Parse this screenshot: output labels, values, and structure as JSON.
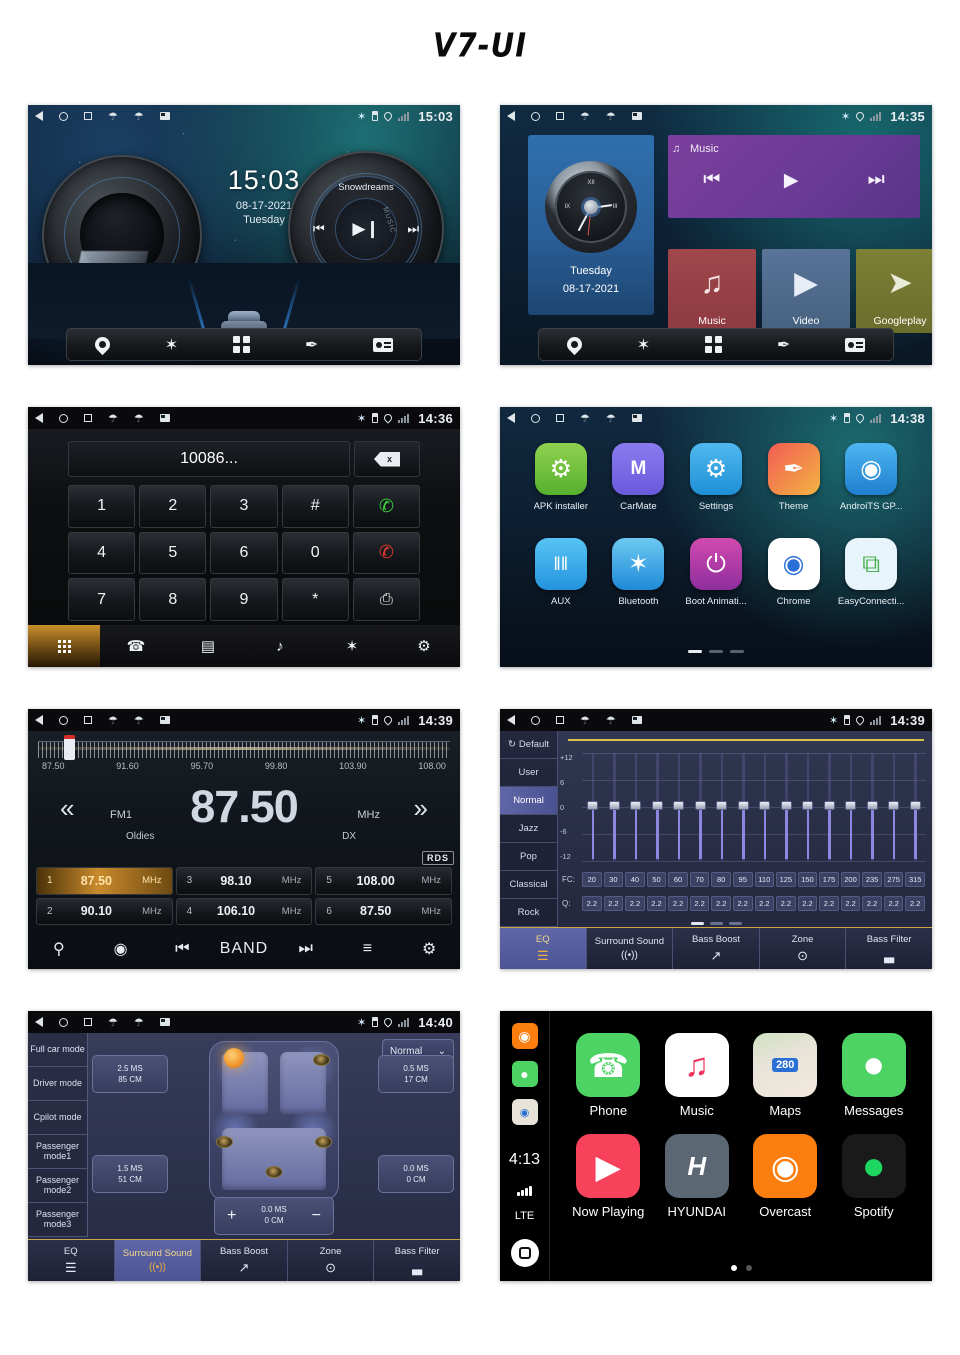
{
  "page": {
    "title": "V7-UI"
  },
  "panels": [
    {
      "id": "home-screen",
      "status": {
        "time": "15:03",
        "nav_icons": [
          "back-icon",
          "home-icon",
          "recents-icon",
          "usb-icon",
          "usb-icon",
          "sd-card-icon"
        ],
        "right_icons": [
          "bluetooth-icon",
          "battery-icon",
          "location-icon",
          "signal-icon"
        ]
      },
      "clock": {
        "time": "15:03",
        "date": "08-17-2021",
        "day": "Tuesday"
      },
      "media": {
        "track": "Snowdreams",
        "label": "MUSIC",
        "prev": "⏮",
        "play": "▶❙",
        "next": "⏭",
        "bluetooth": "✶"
      },
      "dock": [
        "navigation-icon",
        "bluetooth-icon",
        "apps-icon",
        "theme-icon",
        "radio-icon"
      ]
    },
    {
      "id": "widget-screen",
      "status": {
        "time": "14:35"
      },
      "clock_widget": {
        "day": "Tuesday",
        "date": "08-17-2021",
        "n12": "XII",
        "n3": "III",
        "n9": "IX"
      },
      "music_widget": {
        "title": "Music",
        "note": "♫",
        "prev": "⏮",
        "play": "▶",
        "next": "⏭"
      },
      "tiles": [
        {
          "label": "Music",
          "glyph": "♫"
        },
        {
          "label": "Video",
          "glyph": "▶"
        },
        {
          "label": "Googleplay",
          "glyph": "➤"
        }
      ],
      "dock": [
        "navigation-icon",
        "bluetooth-icon",
        "apps-icon",
        "theme-icon",
        "radio-icon"
      ]
    },
    {
      "id": "dialer-screen",
      "status": {
        "time": "14:36"
      },
      "input": {
        "value": "10086...",
        "delete_label": "x"
      },
      "keys": [
        "1",
        "2",
        "3",
        "#",
        "✆",
        "4",
        "5",
        "6",
        "0",
        "✆",
        "7",
        "8",
        "9",
        "*",
        "⎙"
      ],
      "bottom": [
        "keypad-icon",
        "call-log-icon",
        "contacts-icon",
        "bt-audio-icon",
        "bt-phone-icon",
        "settings-icon"
      ]
    },
    {
      "id": "app-drawer",
      "status": {
        "time": "14:38"
      },
      "apps": [
        {
          "label": "APK installer",
          "glyph": "⚙",
          "color1": "#8fd14f",
          "color2": "#57b02e"
        },
        {
          "label": "CarMate",
          "glyph": "M",
          "color1": "#8b7bf0",
          "color2": "#6a5adc"
        },
        {
          "label": "Settings",
          "glyph": "⚙",
          "color1": "#4fb9ef",
          "color2": "#1f8fd6"
        },
        {
          "label": "Theme",
          "glyph": "✎",
          "color1": "#f25c54",
          "color2": "#f2b441"
        },
        {
          "label": "AndroiTS GP...",
          "glyph": "◉",
          "color1": "#4db6f0",
          "color2": "#1f7fd0"
        },
        {
          "label": "AUX",
          "glyph": "‖‖",
          "color1": "#58c4f5",
          "color2": "#2493dd"
        },
        {
          "label": "Bluetooth",
          "glyph": "✶",
          "color1": "#6cc9f2",
          "color2": "#1f8ad8"
        },
        {
          "label": "Boot Animati...",
          "glyph": "⏻",
          "color1": "#d14ab0",
          "color2": "#8e2e9c"
        },
        {
          "label": "Chrome",
          "glyph": "●",
          "color1": "#f4f6f8",
          "color2": "#dfe3e8"
        },
        {
          "label": "EasyConnecti...",
          "glyph": "⧉",
          "color1": "#e8f4fb",
          "color2": "#cfe6f5"
        }
      ],
      "pager": {
        "count": 3,
        "active": 0
      }
    },
    {
      "id": "radio-screen",
      "status": {
        "time": "14:39"
      },
      "scale_labels": [
        "87.50",
        "91.60",
        "95.70",
        "99.80",
        "103.90",
        "108.00"
      ],
      "tuner": {
        "band": "FM1",
        "frequency": "87.50",
        "unit": "MHz",
        "genre": "Oldies",
        "mode": "DX",
        "rds": "RDS",
        "prev": "«",
        "next": "»"
      },
      "presets": [
        {
          "n": "1",
          "freq": "87.50",
          "unit": "MHz",
          "active": true
        },
        {
          "n": "3",
          "freq": "98.10",
          "unit": "MHz",
          "active": false
        },
        {
          "n": "5",
          "freq": "108.00",
          "unit": "MHz",
          "active": false
        },
        {
          "n": "2",
          "freq": "90.10",
          "unit": "MHz",
          "active": false
        },
        {
          "n": "4",
          "freq": "106.10",
          "unit": "MHz",
          "active": false
        },
        {
          "n": "6",
          "freq": "87.50",
          "unit": "MHz",
          "active": false
        }
      ],
      "bottom": {
        "search": "⚲",
        "scan": "◉",
        "prev": "⏮",
        "band": "BAND",
        "next": "⏭",
        "eq": "≡",
        "settings": "⚙"
      }
    },
    {
      "id": "equalizer-screen",
      "status": {
        "time": "14:39"
      },
      "presets": [
        "Default",
        "User",
        "Normal",
        "Jazz",
        "Pop",
        "Classical",
        "Rock"
      ],
      "selected_preset": "Normal",
      "axis": [
        "+12",
        "6",
        "0",
        "-6",
        "-12"
      ],
      "fc_label": "FC:",
      "q_label": "Q:",
      "fc_values": [
        "20",
        "30",
        "40",
        "50",
        "60",
        "70",
        "80",
        "95",
        "110",
        "125",
        "150",
        "175",
        "200",
        "235",
        "275",
        "315"
      ],
      "q_values": [
        "2.2",
        "2.2",
        "2.2",
        "2.2",
        "2.2",
        "2.2",
        "2.2",
        "2.2",
        "2.2",
        "2.2",
        "2.2",
        "2.2",
        "2.2",
        "2.2",
        "2.2",
        "2.2"
      ],
      "pager": {
        "count": 3,
        "active": 0
      },
      "tabs": [
        {
          "label": "EQ",
          "glyph": "☰",
          "active": true
        },
        {
          "label": "Surround Sound",
          "glyph": "((•))",
          "active": false
        },
        {
          "label": "Bass Boost",
          "glyph": "↗",
          "active": false
        },
        {
          "label": "Zone",
          "glyph": "⊙",
          "active": false
        },
        {
          "label": "Bass Filter",
          "glyph": "▃",
          "active": false
        }
      ]
    },
    {
      "id": "surround-screen",
      "status": {
        "time": "14:40"
      },
      "modes": [
        "Full car mode",
        "Driver mode",
        "Cpilot mode",
        "Passenger mode1",
        "Passenger mode2",
        "Passenger mode3"
      ],
      "mode_select": {
        "value": "Normal",
        "chevron": "⌄"
      },
      "delays": [
        {
          "ms": "2.5 MS",
          "cm": "85 CM"
        },
        {
          "ms": "0.5 MS",
          "cm": "17 CM"
        },
        {
          "ms": "1.5 MS",
          "cm": "51 CM"
        },
        {
          "ms": "0.0 MS",
          "cm": "0 CM"
        }
      ],
      "stepper": {
        "plus": "+",
        "minus": "−",
        "ms": "0.0 MS",
        "cm": "0 CM"
      },
      "tabs": [
        {
          "label": "EQ",
          "glyph": "☰",
          "active": false
        },
        {
          "label": "Surround Sound",
          "glyph": "((•))",
          "active": true
        },
        {
          "label": "Bass Boost",
          "glyph": "↗",
          "active": false
        },
        {
          "label": "Zone",
          "glyph": "⊙",
          "active": false
        },
        {
          "label": "Bass Filter",
          "glyph": "▃",
          "active": false
        }
      ]
    },
    {
      "id": "carplay-screen",
      "sidebar": {
        "time": "4:13",
        "network": "LTE",
        "minis": [
          "overcast-icon",
          "messages-icon",
          "maps-icon"
        ],
        "home": "home-button"
      },
      "apps": [
        {
          "label": "Phone",
          "glyph": "✆",
          "bg": "#4cd363",
          "fg": "#ffffff"
        },
        {
          "label": "Music",
          "glyph": "♫",
          "bg": "#ffffff",
          "fg": "#f0335a"
        },
        {
          "label": "Maps",
          "glyph": "280",
          "bg": "#e8e3d8",
          "fg": "#2a6fd6"
        },
        {
          "label": "Messages",
          "glyph": "●",
          "bg": "#4cd363",
          "fg": "#ffffff"
        },
        {
          "label": "Now Playing",
          "glyph": "▶",
          "bg": "#f8415b",
          "fg": "#ffffff"
        },
        {
          "label": "HYUNDAI",
          "glyph": "H",
          "bg": "#5b6773",
          "fg": "#ffffff"
        },
        {
          "label": "Overcast",
          "glyph": "◉",
          "bg": "#fc7e0f",
          "fg": "#ffffff"
        },
        {
          "label": "Spotify",
          "glyph": "≡",
          "bg": "#1a1a1a",
          "fg": "#1ed760"
        }
      ],
      "pager": {
        "count": 2,
        "active": 0
      }
    }
  ]
}
